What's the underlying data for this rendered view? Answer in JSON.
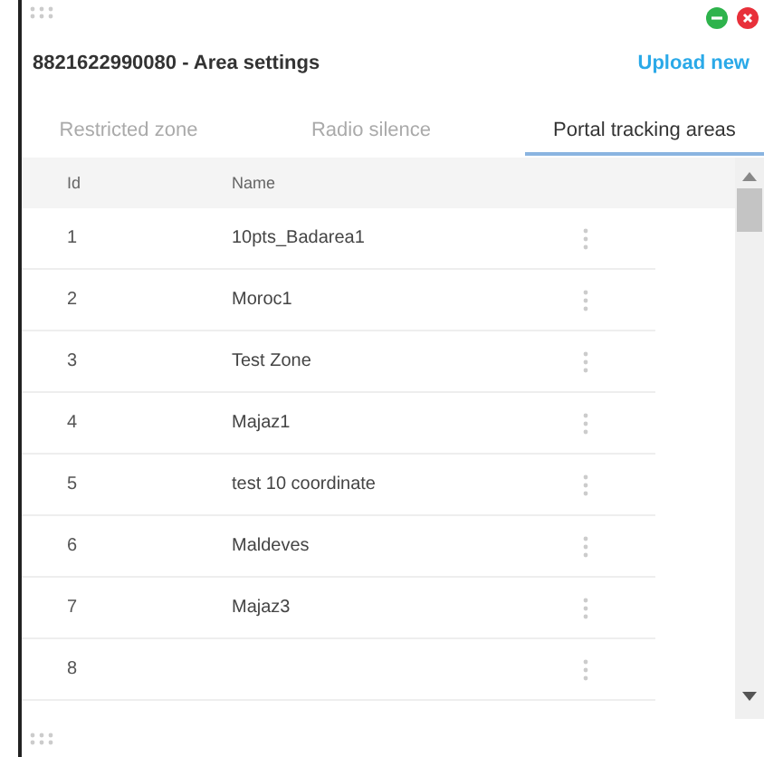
{
  "window": {
    "title": "8821622990080 - Area settings",
    "action": "Upload new"
  },
  "tabs": [
    {
      "label": "Restricted zone",
      "selected": false
    },
    {
      "label": "Radio silence",
      "selected": false
    },
    {
      "label": "Portal tracking areas",
      "selected": true
    }
  ],
  "table": {
    "columns": [
      "Id",
      "Name"
    ],
    "rows": [
      {
        "id": "1",
        "name": "10pts_Badarea1"
      },
      {
        "id": "2",
        "name": "Moroc1"
      },
      {
        "id": "3",
        "name": "Test Zone"
      },
      {
        "id": "4",
        "name": "Majaz1"
      },
      {
        "id": "5",
        "name": "test 10 coordinate"
      },
      {
        "id": "6",
        "name": "Maldeves"
      },
      {
        "id": "7",
        "name": "Majaz3"
      },
      {
        "id": "8"
      }
    ]
  }
}
